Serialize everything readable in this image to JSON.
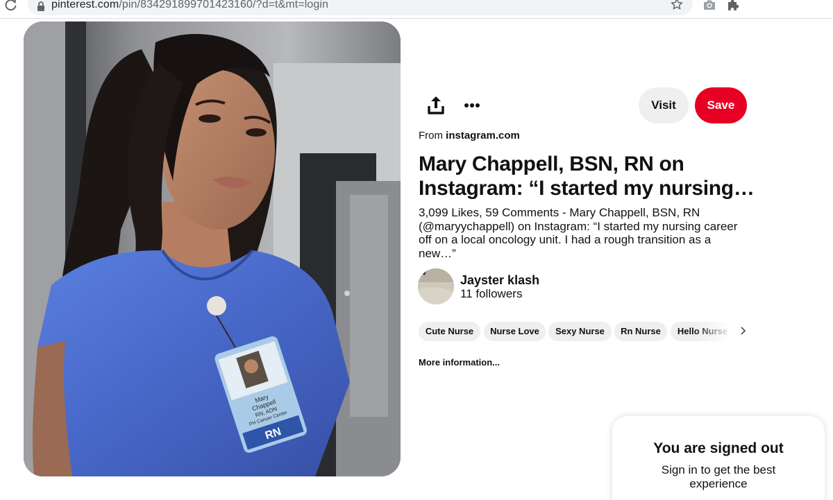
{
  "browser": {
    "url_host": "pinterest.com",
    "url_path": "/pin/834291899701423160/?d=t&mt=login"
  },
  "pin": {
    "from_prefix": "From",
    "source_domain": "instagram.com",
    "title": "Mary Chappell, BSN, RN on Instagram: “I started my nursing…",
    "description": "3,099 Likes, 59 Comments - Mary Chappell, BSN, RN (@maryychappell) on Instagram: “I started my nursing career off on a local oncology unit. I had a rough transition as a new…”",
    "badge_text": {
      "name_line1": "Mary",
      "name_line2": "Chappell",
      "name_line3": "RN, ADN",
      "name_line4": "PH Cancer Center",
      "role": "RN"
    }
  },
  "actions": {
    "visit_label": "Visit",
    "save_label": "Save"
  },
  "creator": {
    "name": "Jayster klash",
    "followers": "11 followers"
  },
  "tags": [
    "Cute Nurse",
    "Nurse Love",
    "Sexy Nurse",
    "Rn Nurse",
    "Hello Nurse"
  ],
  "more_info_label": "More information...",
  "signed_out": {
    "title": "You are signed out",
    "subtitle": "Sign in to get the best experience"
  },
  "colors": {
    "save_red": "#e60023",
    "button_gray": "#efefef",
    "text_primary": "#111111",
    "scrub_blue": "#4b6fd0"
  },
  "icons": [
    "reload-icon",
    "lock-icon",
    "star-icon",
    "camera-icon",
    "puzzle-icon",
    "share-icon",
    "more-icon",
    "chevron-right-icon"
  ]
}
